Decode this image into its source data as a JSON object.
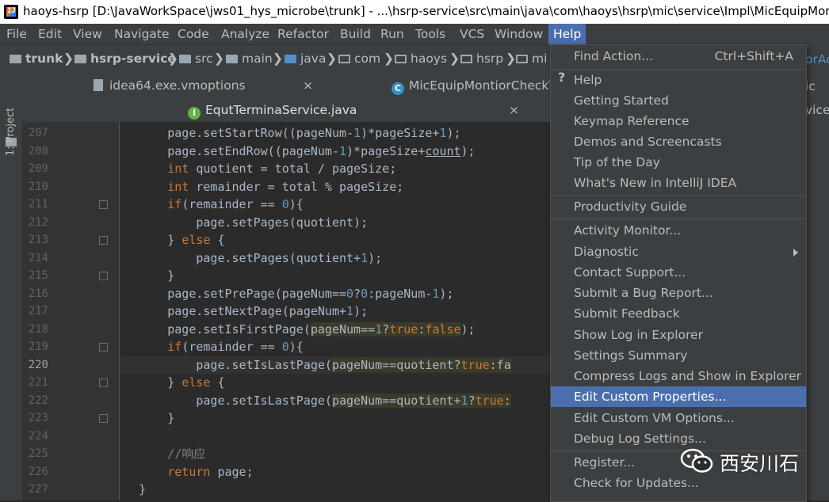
{
  "window": {
    "title": "haoys-hsrp [D:\\JavaWorkSpace\\jws01_hys_microbe\\trunk] - ...\\hsrp-service\\src\\main\\java\\com\\haoys\\hsrp\\mic\\service\\Impl\\MicEquipMontio"
  },
  "menubar": {
    "items": [
      "File",
      "Edit",
      "View",
      "Navigate",
      "Code",
      "Analyze",
      "Refactor",
      "Build",
      "Run",
      "Tools",
      "VCS",
      "Window",
      "Help"
    ]
  },
  "breadcrumbs": [
    "trunk",
    "hsrp-service",
    "src",
    "main",
    "java",
    "com",
    "haoys",
    "hsrp",
    "mi"
  ],
  "right_strip": {
    "breadcrumb_tail": "orAc",
    "tab1_tail": "ic",
    "tab2_tail": "vicel"
  },
  "tabs": {
    "row1": [
      {
        "label": "idea64.exe.vmoptions",
        "close": "×"
      },
      {
        "label": "MicEquipMontiorCheckT"
      }
    ],
    "row2": [
      {
        "label": "EqutTerminaService.java",
        "close": "×"
      }
    ]
  },
  "sidebar": {
    "project_label": "1: Project"
  },
  "editor": {
    "current_line": 220,
    "lines": [
      {
        "n": 207,
        "text": "        page.setStartRow((pageNum-1)*pageSize+1);"
      },
      {
        "n": 208,
        "text": "        page.setEndRow((pageNum-1)*pageSize+count);"
      },
      {
        "n": 209,
        "text": "        int quotient = total / pageSize;"
      },
      {
        "n": 210,
        "text": "        int remainder = total % pageSize;"
      },
      {
        "n": 211,
        "text": "        if(remainder == 0){"
      },
      {
        "n": 212,
        "text": "            page.setPages(quotient);"
      },
      {
        "n": 213,
        "text": "        } else {"
      },
      {
        "n": 214,
        "text": "            page.setPages(quotient+1);"
      },
      {
        "n": 215,
        "text": "        }"
      },
      {
        "n": 216,
        "text": "        page.setPrePage(pageNum==0?0:pageNum-1);"
      },
      {
        "n": 217,
        "text": "        page.setNextPage(pageNum+1);"
      },
      {
        "n": 218,
        "text": "        page.setIsFirstPage(pageNum==1?true:false);"
      },
      {
        "n": 219,
        "text": "        if(remainder == 0){"
      },
      {
        "n": 220,
        "text": "            page.setIsLastPage(pageNum==quotient?true:fa"
      },
      {
        "n": 221,
        "text": "        } else {"
      },
      {
        "n": 222,
        "text": "            page.setIsLastPage(pageNum==quotient+1?true:"
      },
      {
        "n": 223,
        "text": "        }"
      },
      {
        "n": 224,
        "text": ""
      },
      {
        "n": 225,
        "text": "        //响应"
      },
      {
        "n": 226,
        "text": "        return page;"
      },
      {
        "n": 227,
        "text": "    }"
      }
    ]
  },
  "help_menu": {
    "items": [
      {
        "label": "Find Action...",
        "shortcut": "Ctrl+Shift+A"
      },
      {
        "label": "Help",
        "icon": "question-icon"
      },
      {
        "label": "Getting Started"
      },
      {
        "label": "Keymap Reference"
      },
      {
        "label": "Demos and Screencasts"
      },
      {
        "label": "Tip of the Day"
      },
      {
        "label": "What's New in IntelliJ IDEA"
      },
      {
        "label": "Productivity Guide"
      },
      {
        "label": "Activity Monitor..."
      },
      {
        "label": "Diagnostic",
        "submenu": true
      },
      {
        "label": "Contact Support..."
      },
      {
        "label": "Submit a Bug Report..."
      },
      {
        "label": "Submit Feedback"
      },
      {
        "label": "Show Log in Explorer"
      },
      {
        "label": "Settings Summary"
      },
      {
        "label": "Compress Logs and Show in Explorer"
      },
      {
        "label": "Edit Custom Properties...",
        "selected": true
      },
      {
        "label": "Edit Custom VM Options..."
      },
      {
        "label": "Debug Log Settings..."
      },
      {
        "label": "Register..."
      },
      {
        "label": "Check for Updates..."
      }
    ]
  },
  "watermark": {
    "text": "西安川石",
    "icon": "wechat-icon"
  },
  "colors": {
    "accent": "#4b6eaf",
    "keyword": "#cc7832",
    "number": "#6897bb",
    "comment": "#808080",
    "text": "#a9b7c6"
  }
}
